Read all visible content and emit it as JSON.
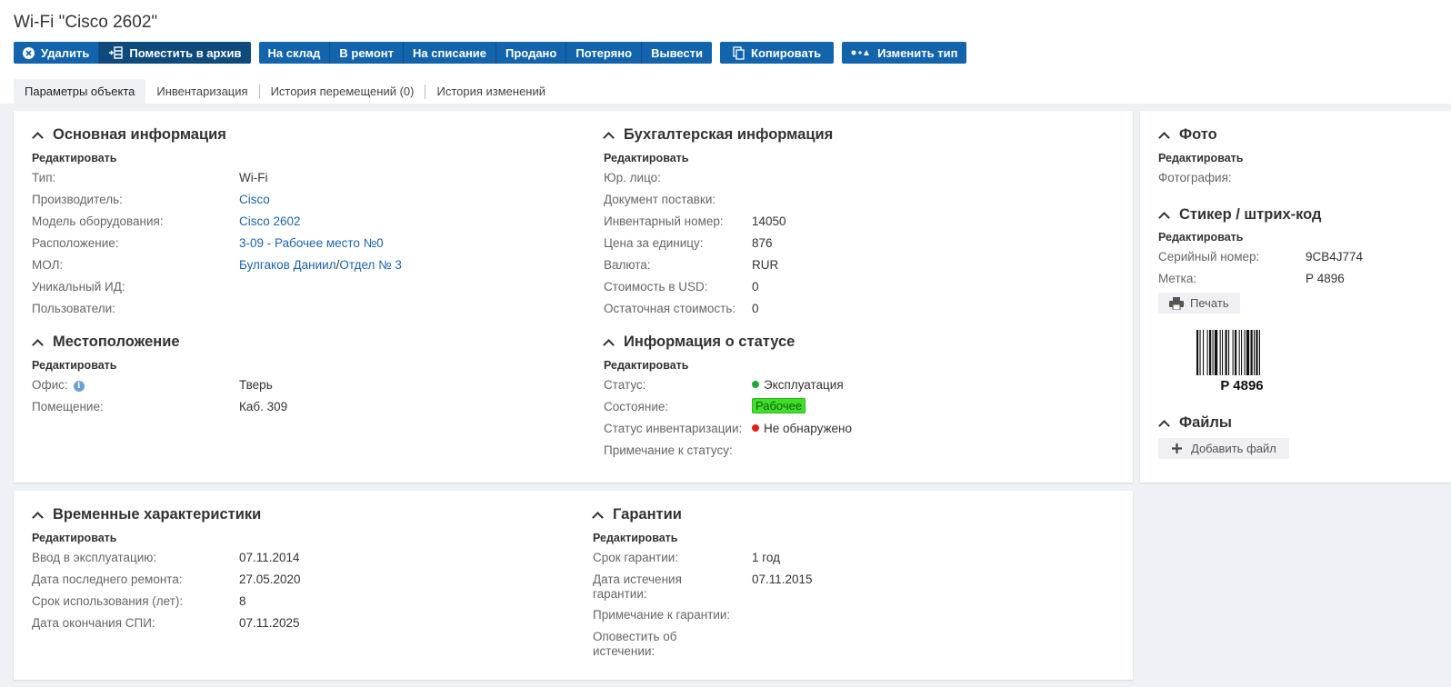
{
  "page_title": "Wi-Fi \"Cisco 2602\"",
  "toolbar": {
    "delete": "Удалить",
    "archive": "Поместить в архив",
    "to_stock": "На склад",
    "to_repair": "В ремонт",
    "write_off": "На списание",
    "sold": "Продано",
    "lost": "Потеряно",
    "withdraw": "Вывести",
    "copy": "Копировать",
    "change_type": "Изменить тип"
  },
  "tabs": [
    "Параметры объекта",
    "Инвентаризация",
    "История перемещений (0)",
    "История изменений"
  ],
  "edit_label": "Редактировать",
  "main_info": {
    "title": "Основная информация",
    "type_label": "Тип:",
    "type_value": "Wi-Fi",
    "manufacturer_label": "Производитель:",
    "manufacturer_value": "Cisco",
    "model_label": "Модель оборудования:",
    "model_value": "Cisco 2602",
    "location_label": "Расположение:",
    "location_value": "3-09 - Рабочее место №0",
    "mol_label": "МОЛ:",
    "mol_person": "Булгаков Даниил",
    "mol_sep": "/",
    "mol_dept": "Отдел № 3",
    "uid_label": "Уникальный ИД:",
    "users_label": "Пользователи:"
  },
  "accounting": {
    "title": "Бухгалтерская информация",
    "legal_label": "Юр. лицо:",
    "doc_label": "Документ поставки:",
    "inv_label": "Инвентарный номер:",
    "inv_value": "14050",
    "price_label": "Цена за единицу:",
    "price_value": "876",
    "currency_label": "Валюта:",
    "currency_value": "RUR",
    "usd_label": "Стоимость в USD:",
    "usd_value": "0",
    "residual_label": "Остаточная стоимость:",
    "residual_value": "0"
  },
  "location": {
    "title": "Местоположение",
    "office_label": "Офис:",
    "office_value": "Тверь",
    "room_label": "Помещение:",
    "room_value": "Каб. 309"
  },
  "status": {
    "title": "Информация о статусе",
    "status_label": "Статус:",
    "status_value": "Эксплуатация",
    "state_label": "Состояние:",
    "state_value": "Рабочее",
    "inv_status_label": "Статус инвентаризации:",
    "inv_status_value": "Не обнаружено",
    "note_label": "Примечание к статусу:",
    "colors": {
      "ok": "#21a83a",
      "bad": "#e0201b"
    }
  },
  "photo": {
    "title": "Фото",
    "photo_label": "Фотография:"
  },
  "sticker": {
    "title": "Стикер / штрих-код",
    "serial_label": "Серийный номер:",
    "serial_value": "9CB4J774",
    "tag_label": "Метка:",
    "tag_value": "Р 4896",
    "print_label": "Печать",
    "barcode_text": "P 4896"
  },
  "files": {
    "title": "Файлы",
    "add_label": "Добавить файл"
  },
  "time": {
    "title": "Временные характеристики",
    "commission_label": "Ввод в эксплуатацию:",
    "commission_value": "07.11.2014",
    "last_repair_label": "Дата последнего ремонта:",
    "last_repair_value": "27.05.2020",
    "usage_label": "Срок использования (лет):",
    "usage_value": "8",
    "spi_end_label": "Дата окончания СПИ:",
    "spi_end_value": "07.11.2025"
  },
  "warranty": {
    "title": "Гарантии",
    "term_label": "Срок гарантии:",
    "term_value": "1 год",
    "expiry_label_1": "Дата истечения",
    "expiry_label_2": "гарантии:",
    "expiry_value": "07.11.2015",
    "note_label": "Примечание к гарантии:",
    "notify_label_1": "Оповестить об",
    "notify_label_2": "истечении:"
  },
  "accent_color": "#1264ac"
}
